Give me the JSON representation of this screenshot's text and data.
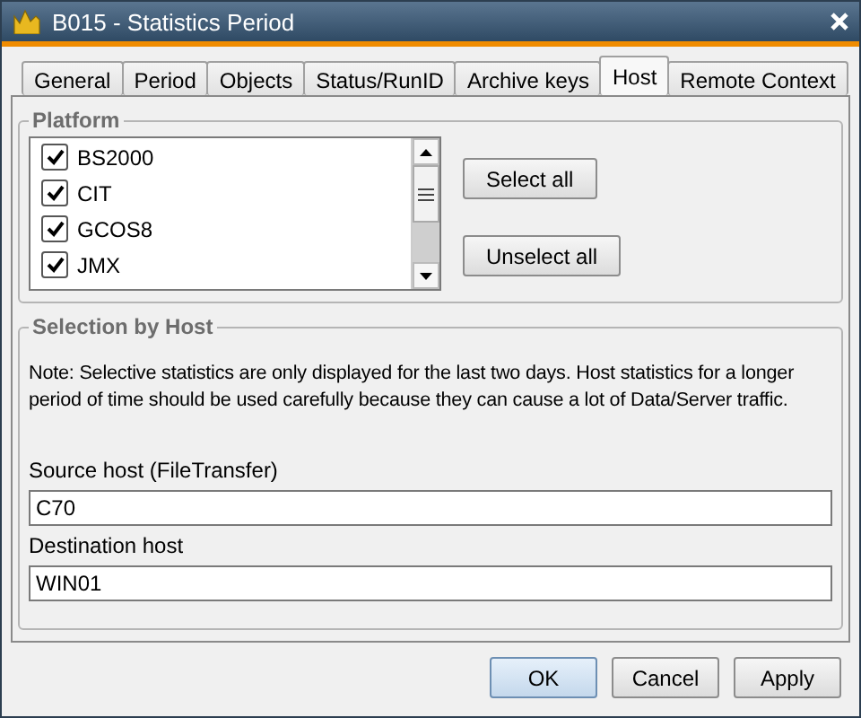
{
  "window": {
    "title": "B015 - Statistics Period"
  },
  "tabs": [
    {
      "label": "General",
      "selected": false
    },
    {
      "label": "Period",
      "selected": false
    },
    {
      "label": "Objects",
      "selected": false
    },
    {
      "label": "Status/RunID",
      "selected": false
    },
    {
      "label": "Archive keys",
      "selected": false
    },
    {
      "label": "Host",
      "selected": true
    },
    {
      "label": "Remote Context",
      "selected": false
    }
  ],
  "platform": {
    "title": "Platform",
    "items": [
      {
        "label": "BS2000",
        "checked": true
      },
      {
        "label": "CIT",
        "checked": true
      },
      {
        "label": "GCOS8",
        "checked": true
      },
      {
        "label": "JMX",
        "checked": true
      }
    ],
    "buttons": [
      "Select all",
      "Unselect all"
    ]
  },
  "selection_by_host": {
    "title": "Selection by Host",
    "note": "Note: Selective statistics are only displayed for the last two days. Host statistics for a longer period of time should be used carefully because they can cause a lot of Data/Server traffic.",
    "fields": [
      {
        "label": "Source host (FileTransfer)",
        "value": "C70"
      },
      {
        "label": "Destination host",
        "value": "WIN01"
      }
    ]
  },
  "buttons": [
    {
      "label": "OK",
      "default": true
    },
    {
      "label": "Cancel",
      "default": false
    },
    {
      "label": "Apply",
      "default": false
    }
  ]
}
